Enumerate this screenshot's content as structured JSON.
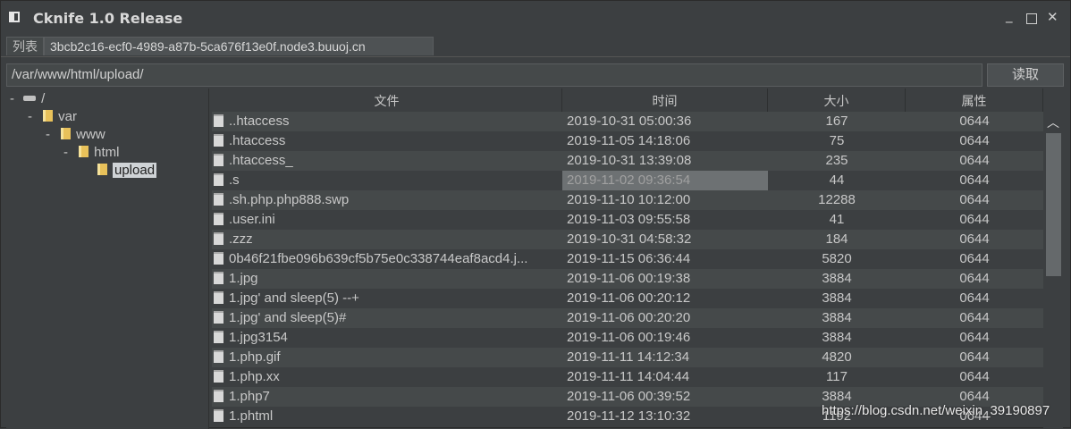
{
  "window": {
    "title": "Cknife 1.0 Release",
    "controls": {
      "minimize": "_",
      "close": "✕"
    }
  },
  "tabs": [
    {
      "label": "列表"
    },
    {
      "label": "3bcb2c16-ecf0-4989-a87b-5ca676f13e0f.node3.buuoj.cn"
    }
  ],
  "path_bar": {
    "value": "/var/www/html/upload/",
    "read_button": "读取"
  },
  "tree": [
    {
      "label": "/",
      "toggle": "-"
    },
    {
      "label": "var",
      "toggle": "-"
    },
    {
      "label": "www",
      "toggle": "-"
    },
    {
      "label": "html",
      "toggle": "-"
    },
    {
      "label": "upload",
      "selected": true
    }
  ],
  "table": {
    "headers": [
      "文件",
      "时间",
      "大小",
      "属性"
    ],
    "rows": [
      {
        "name": "..htaccess",
        "time": "2019-10-31 05:00:36",
        "size": "167",
        "attr": "0644"
      },
      {
        "name": ".htaccess",
        "time": "2019-11-05 14:18:06",
        "size": "75",
        "attr": "0644"
      },
      {
        "name": ".htaccess_",
        "time": "2019-10-31 13:39:08",
        "size": "235",
        "attr": "0644"
      },
      {
        "name": ".s",
        "time": "2019-11-02 09:36:54",
        "size": "44",
        "attr": "0644",
        "selected_time": true
      },
      {
        "name": ".sh.php.php888.swp",
        "time": "2019-11-10 10:12:00",
        "size": "12288",
        "attr": "0644"
      },
      {
        "name": ".user.ini",
        "time": "2019-11-03 09:55:58",
        "size": "41",
        "attr": "0644"
      },
      {
        "name": ".zzz",
        "time": "2019-10-31 04:58:32",
        "size": "184",
        "attr": "0644"
      },
      {
        "name": "0b46f21fbe096b639cf5b75e0c338744eaf8acd4.j...",
        "time": "2019-11-15 06:36:44",
        "size": "5820",
        "attr": "0644"
      },
      {
        "name": "1.jpg",
        "time": "2019-11-06 00:19:38",
        "size": "3884",
        "attr": "0644"
      },
      {
        "name": "1.jpg' and sleep(5) --+",
        "time": "2019-11-06 00:20:12",
        "size": "3884",
        "attr": "0644"
      },
      {
        "name": "1.jpg' and sleep(5)#",
        "time": "2019-11-06 00:20:20",
        "size": "3884",
        "attr": "0644"
      },
      {
        "name": "1.jpg3154",
        "time": "2019-11-06 00:19:46",
        "size": "3884",
        "attr": "0644"
      },
      {
        "name": "1.php.gif",
        "time": "2019-11-11 14:12:34",
        "size": "4820",
        "attr": "0644"
      },
      {
        "name": "1.php.xx",
        "time": "2019-11-11 14:04:44",
        "size": "117",
        "attr": "0644"
      },
      {
        "name": "1.php7",
        "time": "2019-11-06 00:39:52",
        "size": "3884",
        "attr": "0644"
      },
      {
        "name": "1.phtml",
        "time": "2019-11-12 13:10:32",
        "size": "1192",
        "attr": "0644"
      }
    ]
  },
  "scrollbar": {
    "up_arrow": "︿"
  },
  "watermark": "https://blog.csdn.net/weixin_39190897",
  "colors": {
    "background": "#3c3f41",
    "row_alt": "#45494a",
    "folder": "#e8c15a"
  }
}
